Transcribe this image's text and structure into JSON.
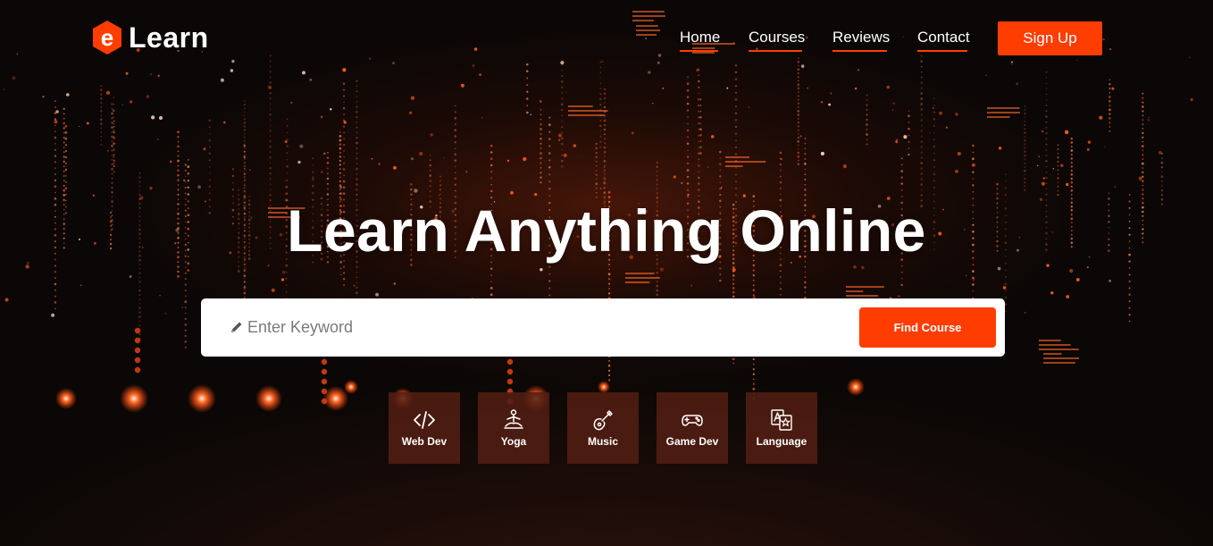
{
  "brand": {
    "logo_letter": "e",
    "name": "Learn",
    "accent": "#ff3d00"
  },
  "nav": {
    "items": [
      {
        "label": "Home"
      },
      {
        "label": "Courses"
      },
      {
        "label": "Reviews"
      },
      {
        "label": "Contact"
      }
    ],
    "signup_label": "Sign Up"
  },
  "hero": {
    "title": "Learn Anything Online"
  },
  "search": {
    "icon": "pencil-icon",
    "placeholder": "Enter Keyword",
    "value": "",
    "button_label": "Find Course"
  },
  "categories": [
    {
      "label": "Web Dev",
      "icon": "code-icon"
    },
    {
      "label": "Yoga",
      "icon": "yoga-icon"
    },
    {
      "label": "Music",
      "icon": "guitar-icon"
    },
    {
      "label": "Game Dev",
      "icon": "gamepad-icon"
    },
    {
      "label": "Language",
      "icon": "translate-icon"
    }
  ]
}
